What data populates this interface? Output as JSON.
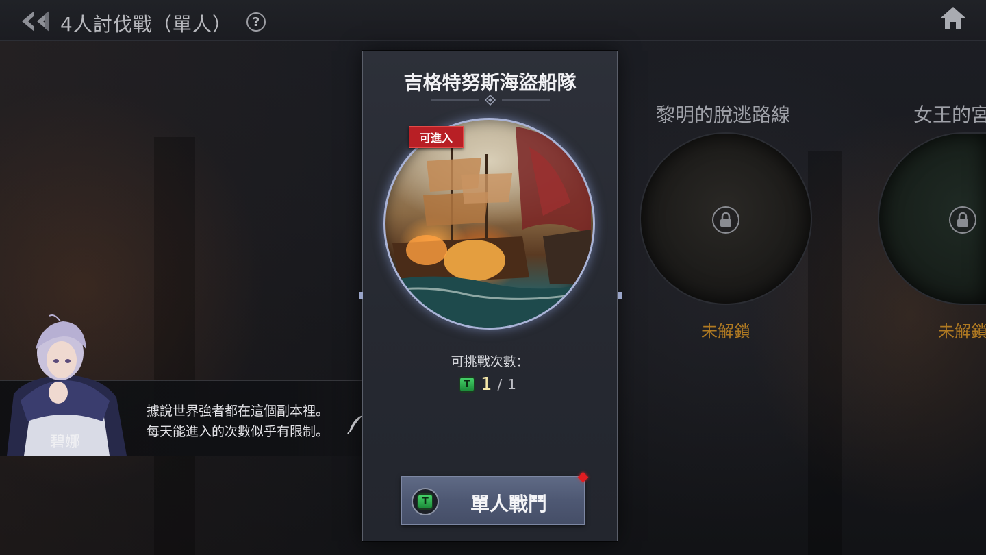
{
  "header": {
    "title": "4人討伐戰（單人）",
    "help_glyph": "?",
    "back_icon": "double-chevron-left-icon",
    "home_icon": "home-icon"
  },
  "selected_dungeon": {
    "name": "吉格特努斯海盜船隊",
    "badge": "可進入",
    "attempts_label": "可挑戰次數：",
    "attempts_current": "1",
    "attempts_separator": "/",
    "attempts_total": "1",
    "ticket_glyph": "T",
    "battle_button_label": "單人戰鬥"
  },
  "locked_dungeons": [
    {
      "name": "黎明的脫逃路線",
      "status": "未解鎖"
    },
    {
      "name": "女王的宮",
      "status": "未解鎖"
    }
  ],
  "npc": {
    "name": "碧娜",
    "line1": "據說世界強者都在這個副本裡。",
    "line2": "每天能進入的次數似乎有限制。"
  },
  "colors": {
    "badge_red": "#b81f25",
    "locked_status": "#b07a22",
    "button_bg": "#4e5873",
    "card_border": "#5a5e69",
    "ticket_green": "#2eb150"
  }
}
